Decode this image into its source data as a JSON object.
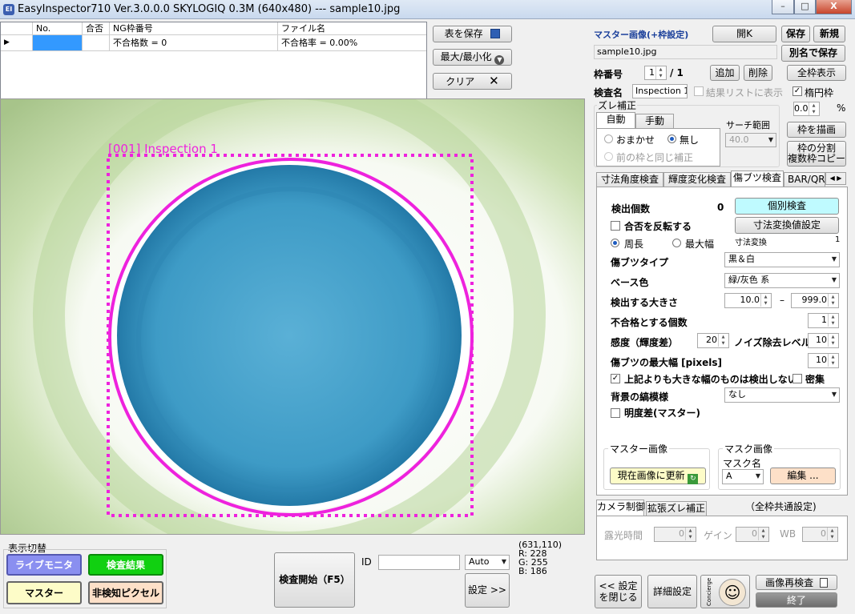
{
  "title": "EasyInspector710 Ver.3.0.0.0 SKYLOGIQ 0.3M   (640x480) --- sample10.jpg",
  "app_icon": "EI",
  "win": {
    "min": "–",
    "max": "□",
    "close": "X"
  },
  "grid": {
    "cols": [
      "No.",
      "合否",
      "NG枠番号",
      "ファイル名"
    ],
    "row": [
      "",
      "",
      "不合格数 = 0",
      "不合格率 = 0.00%"
    ]
  },
  "top_buttons": {
    "save_table": "表を保存",
    "maxmin": "最大/最小化",
    "clear": "クリア"
  },
  "overlay": {
    "label": "[001] Inspection 1"
  },
  "right": {
    "master_label": "マスター画像(+枠設定)",
    "open": "開K",
    "save": "保存",
    "new": "新規",
    "file": "sample10.jpg",
    "save_as": "別名で保存",
    "frame_no_label": "枠番号",
    "frame_no": "1",
    "frame_total": "/ 1",
    "add": "追加",
    "delete": "削除",
    "show_all": "全枠表示",
    "insp_name_label": "検査名",
    "insp_name": "Inspection 1",
    "result_list": "結果リストに表示",
    "ellipse": "楕円枠",
    "pct_value": "0.0",
    "pct": "%",
    "shift_title": "ズレ補正",
    "tab_auto": "自動",
    "tab_manual": "手動",
    "search_range": "サーチ範囲",
    "omakase": "おまかせ",
    "none": "無し",
    "same_as_prev": "前の枠と同じ補正",
    "search_value": "40.0",
    "draw_frame": "枠を描画",
    "split_frame": "枠の分割",
    "copy_frame": "複数枠コピー",
    "tabs": [
      "寸法角度検査",
      "輝度変化検査",
      "傷ブツ検査",
      "BAR/QR"
    ],
    "detect_count_label": "検出個数",
    "detect_count": "0",
    "individual": "個別検査",
    "invert": "合否を反転する",
    "dim_setting": "寸法変換値設定",
    "perimeter": "周長",
    "max_width": "最大幅",
    "dim_conv": "寸法変換",
    "dim_conv_val": "1",
    "defect_type_label": "傷ブツタイプ",
    "defect_type": "黒＆白",
    "base_color_label": "ベース色",
    "base_color": "緑/灰色 系",
    "size_label": "検出する大きさ",
    "size_min": "10.0",
    "dash": "–",
    "size_max": "999.0",
    "ng_count_label": "不合格とする個数",
    "ng_count": "1",
    "sens_label": "感度（輝度差）",
    "sens": "20",
    "noise_label": "ノイズ除去レベル",
    "noise": "10",
    "maxw_label": "傷ブツの最大幅 [pixels]",
    "maxw": "10",
    "ignore_large": "上記よりも大きな幅のものは検出しない",
    "dense": "密集",
    "bg_label": "背景の縞模様",
    "bg": "なし",
    "brightness": "明度差(マスター)",
    "master_img": "マスター画像",
    "update_img": "現在画像に更新",
    "mask_img": "マスク画像",
    "mask_name": "マスク名",
    "mask_val": "A",
    "edit": "編集 ...",
    "cam_tab": "カメラ制御",
    "ext_tab": "拡張ズレ補正",
    "common": "（全枠共通設定)",
    "exposure": "露光時間",
    "exposure_val": "0",
    "gain": "ゲイン",
    "gain_val": "0",
    "wb": "WB",
    "wb_val": "0",
    "close_setting": "<< 設定\nを閉じる",
    "detail": "詳細設定",
    "concierge": "Concierge",
    "reinspect": "画像再検査",
    "quit": "終了"
  },
  "bottom": {
    "display_switch": "表示切替",
    "live": "ライブモニタ",
    "result": "検査結果",
    "master": "マスター",
    "nondetect": "非検知ピクセル",
    "start": "検査開始（F5）",
    "id": "ID",
    "id_value": "",
    "auto": "Auto",
    "setting": "設定 >>",
    "coords": "(631,110)",
    "r": "R: 228",
    "g": "G: 255",
    "b": "B: 186"
  },
  "colors": {
    "magenta": "#ee22dd",
    "live": "#8a8ff0",
    "result": "#11d011",
    "master": "#fdfcc8",
    "nondetect": "#fde0c8",
    "lightcyan": "#bffaff"
  }
}
